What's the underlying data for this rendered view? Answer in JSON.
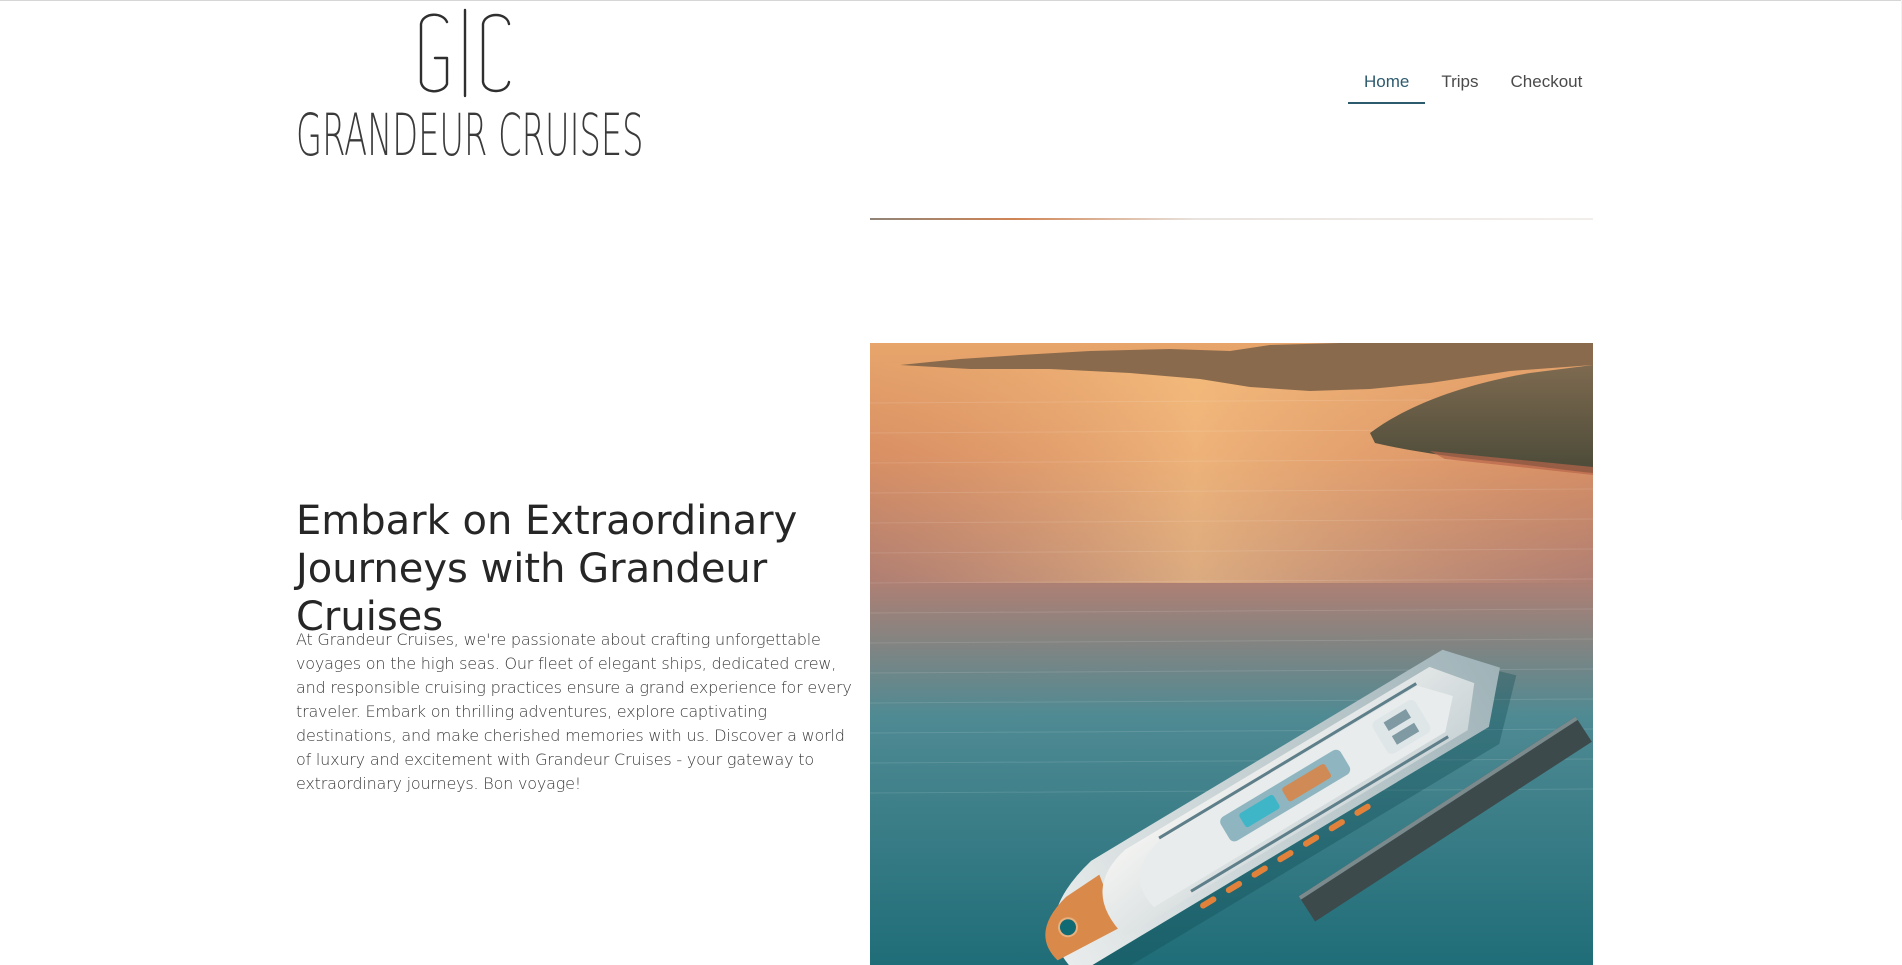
{
  "site": {
    "logo_mark": "G|C",
    "logo_wordmark": "GRANDEUR CRUISES"
  },
  "nav": {
    "items": [
      {
        "label": "Home",
        "active": true
      },
      {
        "label": "Trips",
        "active": false
      },
      {
        "label": "Checkout",
        "active": false
      }
    ],
    "accent_color": "#2d5b6e"
  },
  "hero": {
    "title": "Embark on Extraordinary Journeys with Grandeur Cruises",
    "body": "At Grandeur Cruises, we're passionate about crafting unforgettable voyages on the high seas. Our fleet of elegant ships, dedicated crew, and responsible cruising practices ensure a grand experience for every traveler. Embark on thrilling adventures, explore captivating destinations, and make cherished memories with us. Discover a world of luxury and excitement with Grandeur Cruises - your gateway to extraordinary journeys. Bon voyage!",
    "image_icon": "cruise-ship-photo"
  }
}
